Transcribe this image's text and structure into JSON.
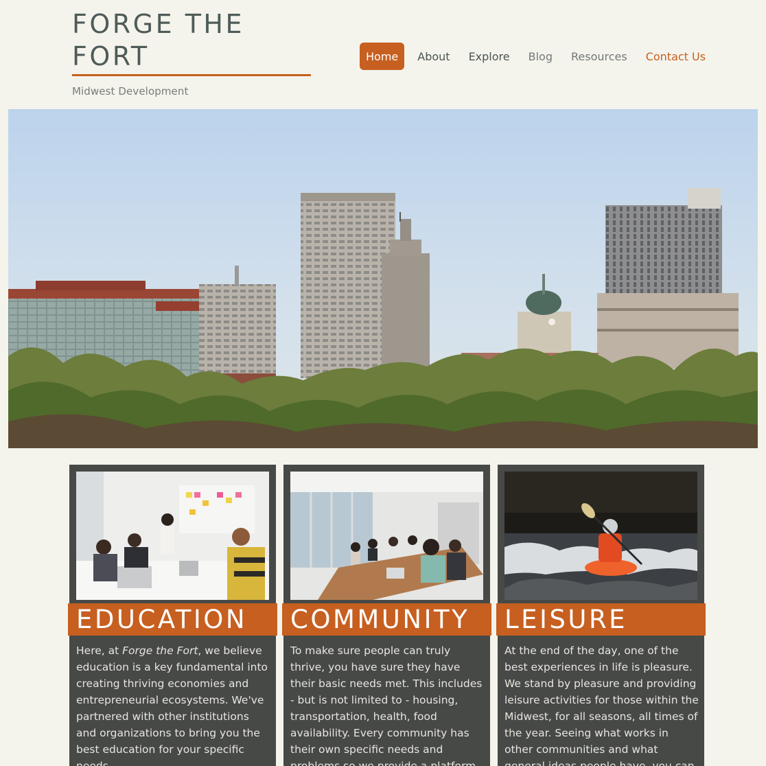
{
  "brand": {
    "title_line1": "FORGE THE",
    "title_line2": "FORT",
    "tagline": "Midwest Development"
  },
  "nav": {
    "items": [
      {
        "label": "Home"
      },
      {
        "label": "About"
      },
      {
        "label": "Explore"
      },
      {
        "label": "Blog"
      },
      {
        "label": "Resources"
      },
      {
        "label": "Contact Us"
      }
    ],
    "active": "Home"
  },
  "colors": {
    "page_background": "#f4f4ec",
    "accent": "#c65f20",
    "card_background": "#474947",
    "heading_text": "#4f5b59"
  },
  "hero": {
    "image": "city-skyline-photo"
  },
  "cards": [
    {
      "image": "team-meeting-whiteboard-photo",
      "heading": "EDUCATION",
      "text_before": "Here, at ",
      "text_em": "Forge the Fort",
      "text_after": ", we believe education is a key fundamental into creating thriving economies and entrepreneurial ecosystems. We've partnered with other institutions and organizations to bring you the best education for your specific needs."
    },
    {
      "image": "conference-room-photo",
      "heading": "COMMUNITY",
      "text": "To make sure people can truly thrive, you have sure they have their basic needs met. This includes - but is not limited to - housing, transportation, health, food availability. Every community has their own specific needs and problems so we provide a platform for people to voice those"
    },
    {
      "image": "kayaker-whitewater-photo",
      "heading": "LEISURE",
      "text": "At the end of the day, one of the best experiences in life is pleasure. We stand by pleasure and providing leisure activities for those within the Midwest, for all seasons, all times of the year. Seeing what works in other communities and what general ideas people have, you can bring these"
    }
  ]
}
